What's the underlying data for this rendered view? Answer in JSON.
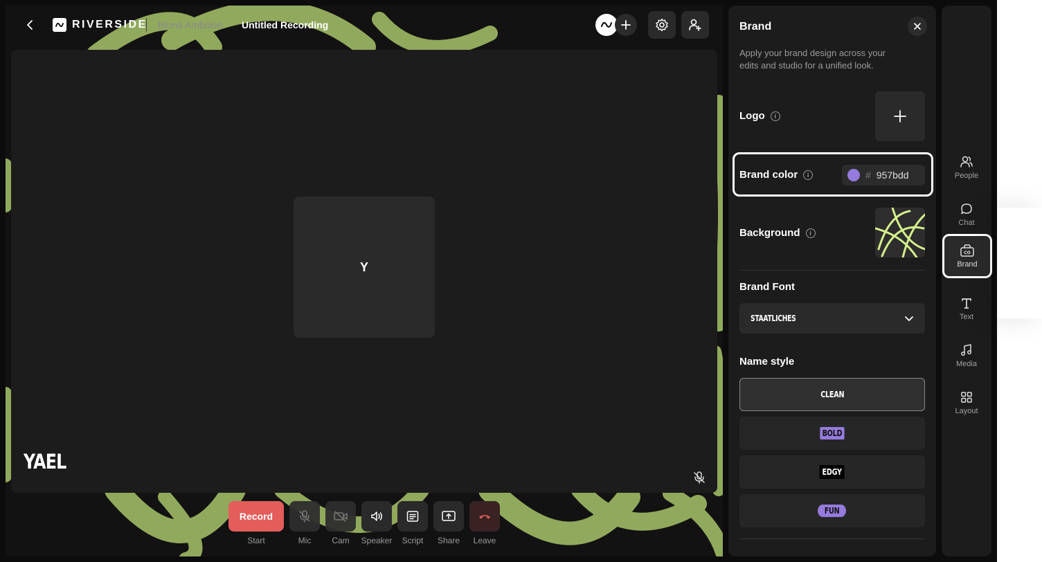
{
  "header": {
    "brand_name": "RIVERSIDE",
    "project_name": "Blond Ambition",
    "recording_title": "Untitled Recording"
  },
  "stage": {
    "tile_initial": "Y",
    "name_tag": "YAEL"
  },
  "controls": {
    "record_label": "Record",
    "items": [
      {
        "label": "Start",
        "icon": "record-button"
      },
      {
        "label": "Mic",
        "icon": "mic-off-icon"
      },
      {
        "label": "Cam",
        "icon": "camera-off-icon"
      },
      {
        "label": "Speaker",
        "icon": "speaker-icon"
      },
      {
        "label": "Script",
        "icon": "script-icon"
      },
      {
        "label": "Share",
        "icon": "share-screen-icon"
      },
      {
        "label": "Leave",
        "icon": "leave-call-icon"
      }
    ]
  },
  "brand_panel": {
    "title": "Brand",
    "description": "Apply your brand design across your edits and studio for a unified look.",
    "logo_label": "Logo",
    "brand_color_label": "Brand color",
    "brand_color_hash": "#",
    "brand_color_value": "957bdd",
    "brand_color_hex": "#957bdd",
    "background_label": "Background",
    "font_title": "Brand Font",
    "font_value": "STAATLICHES",
    "name_style_title": "Name style",
    "name_styles": [
      "CLEAN",
      "BOLD",
      "EDGY",
      "FUN"
    ],
    "selected_name_style": "CLEAN"
  },
  "rail": {
    "items": [
      {
        "label": "People",
        "icon": "people-icon"
      },
      {
        "label": "Chat",
        "icon": "chat-icon"
      },
      {
        "label": "Brand",
        "icon": "brand-icon",
        "active": true
      },
      {
        "label": "Text",
        "icon": "text-icon"
      },
      {
        "label": "Media",
        "icon": "media-icon"
      },
      {
        "label": "Layout",
        "icon": "layout-icon"
      }
    ]
  },
  "colors": {
    "accent": "#957bdd",
    "record": "#e35d5b",
    "leave": "#e35d5b",
    "background_stroke": "#a8c46a"
  }
}
